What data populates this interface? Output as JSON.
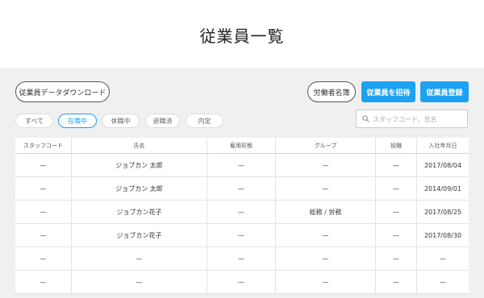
{
  "page_title": "従業員一覧",
  "download_button": "従業員データダウンロード",
  "labor_register_button": "労働者名簿",
  "invite_button": "従業員を招待",
  "register_button": "従業員登録",
  "tabs": [
    {
      "label": "すべて",
      "active": false
    },
    {
      "label": "在職中",
      "active": true
    },
    {
      "label": "休職中",
      "active": false
    },
    {
      "label": "退職済",
      "active": false
    },
    {
      "label": "内定",
      "active": false
    }
  ],
  "search": {
    "placeholder": "スタッフコード、氏名",
    "value": ""
  },
  "table": {
    "columns": [
      "スタッフコード",
      "氏名",
      "雇用形態",
      "グループ",
      "役職",
      "入社年月日"
    ],
    "rows": [
      [
        "—",
        "ジョブカン 太郎",
        "—",
        "—",
        "—",
        "2017/08/04"
      ],
      [
        "—",
        "ジョブカン 太郎",
        "—",
        "—",
        "—",
        "2014/09/01"
      ],
      [
        "—",
        "ジョブカン花子",
        "—",
        "総務 / 労務",
        "—",
        "2017/08/25"
      ],
      [
        "—",
        "ジョブカン花子",
        "—",
        "—",
        "—",
        "2017/08/30"
      ],
      [
        "—",
        "—",
        "—",
        "—",
        "—",
        "—"
      ],
      [
        "—",
        "—",
        "—",
        "—",
        "—",
        "—"
      ]
    ]
  },
  "colors": {
    "accent": "#1da1f2",
    "background": "#f0f0f0"
  }
}
